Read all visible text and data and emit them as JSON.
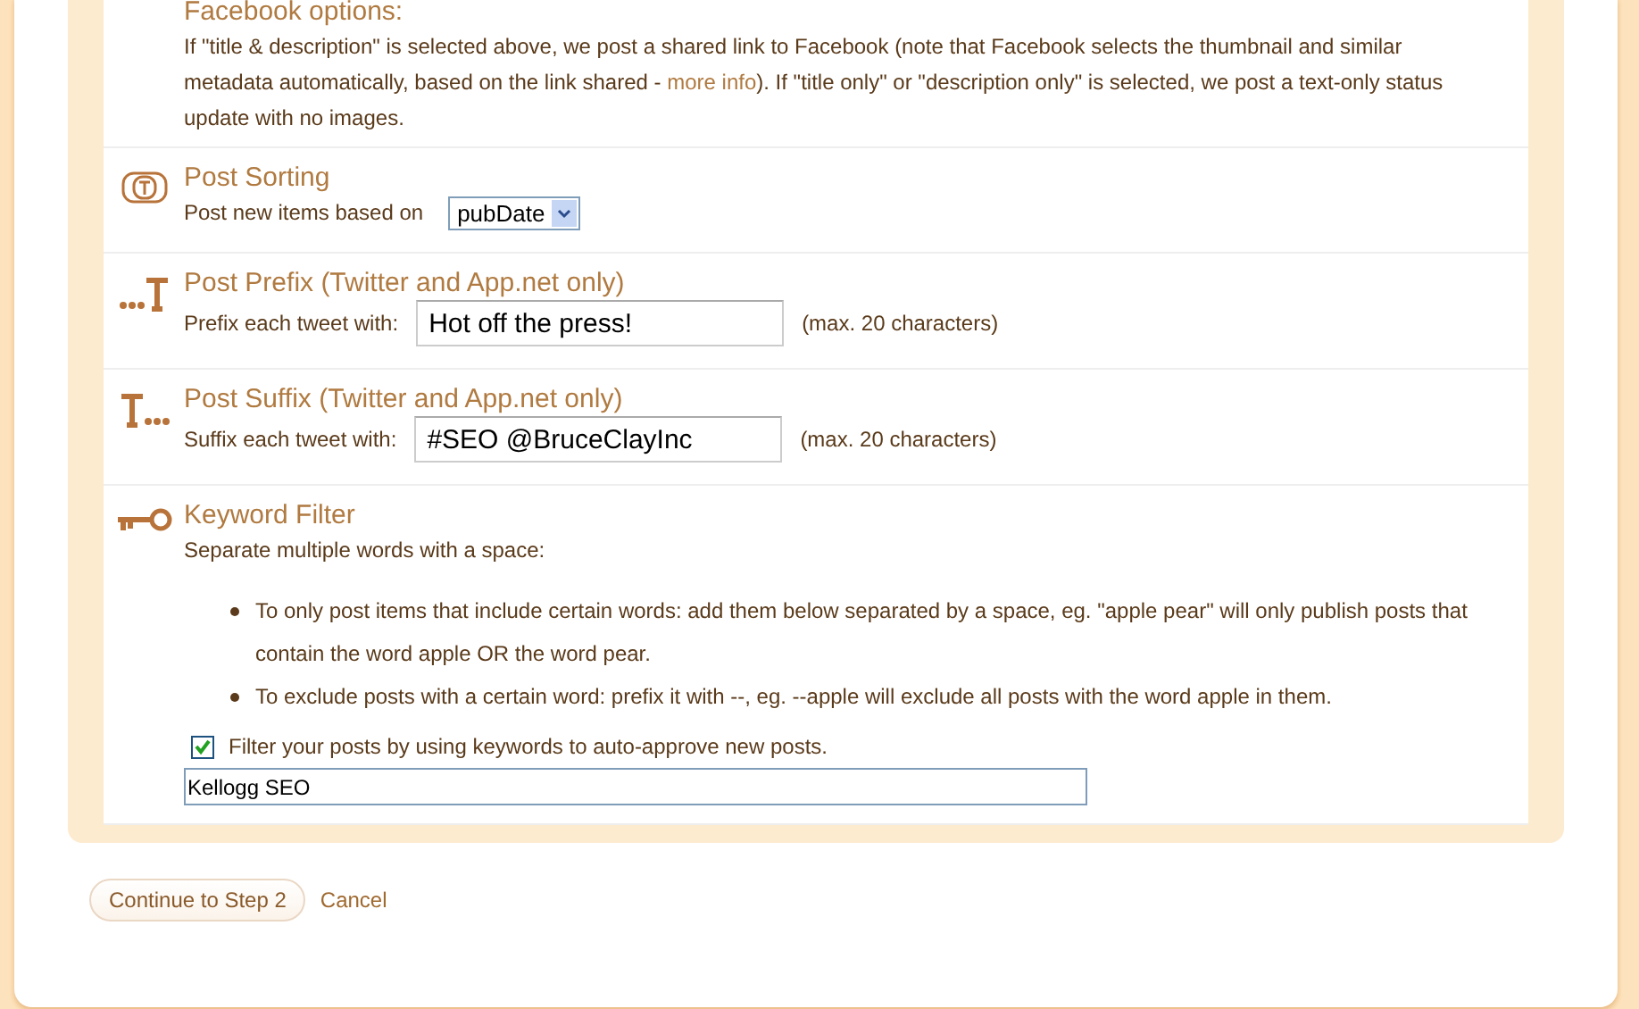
{
  "facebook": {
    "title": "Facebook options:",
    "text_before": "If \"title & description\" is selected above, we post a shared link to Facebook (note that Facebook selects the thumbnail and similar metadata automatically, based on the link shared - ",
    "link": "more info",
    "text_after": "). If \"title only\" or \"description only\" is selected, we post a text-only status update with no images."
  },
  "sections": [
    {
      "kind": "sorting",
      "title": "Post Sorting",
      "label": "Post new items based on",
      "value": "pubDate"
    },
    {
      "kind": "prefix",
      "title": "Post Prefix (Twitter and App.net only)",
      "label": "Prefix each tweet with:",
      "value": "Hot off the press!",
      "hint": "(max. 20 characters)"
    },
    {
      "kind": "suffix",
      "title": "Post Suffix (Twitter and App.net only)",
      "label": "Suffix each tweet with:",
      "value": "#SEO @BruceClayInc",
      "hint": "(max. 20 characters)"
    },
    {
      "kind": "keyword",
      "title": "Keyword Filter",
      "label": "Separate multiple words with a space:",
      "bullets": [
        "To only post items that include certain words: add them below separated by a space, eg. \"apple pear\" will only publish posts that contain the word apple OR the word pear.",
        "To exclude posts with a certain word: prefix it with --, eg. --apple will exclude all posts with the word apple in them."
      ],
      "checkbox": {
        "label": "Filter your posts by using keywords to auto-approve new posts.",
        "checked": true
      },
      "value": "Kellogg SEO"
    }
  ],
  "buttons": {
    "continue": "Continue to Step 2",
    "cancel": "Cancel"
  }
}
